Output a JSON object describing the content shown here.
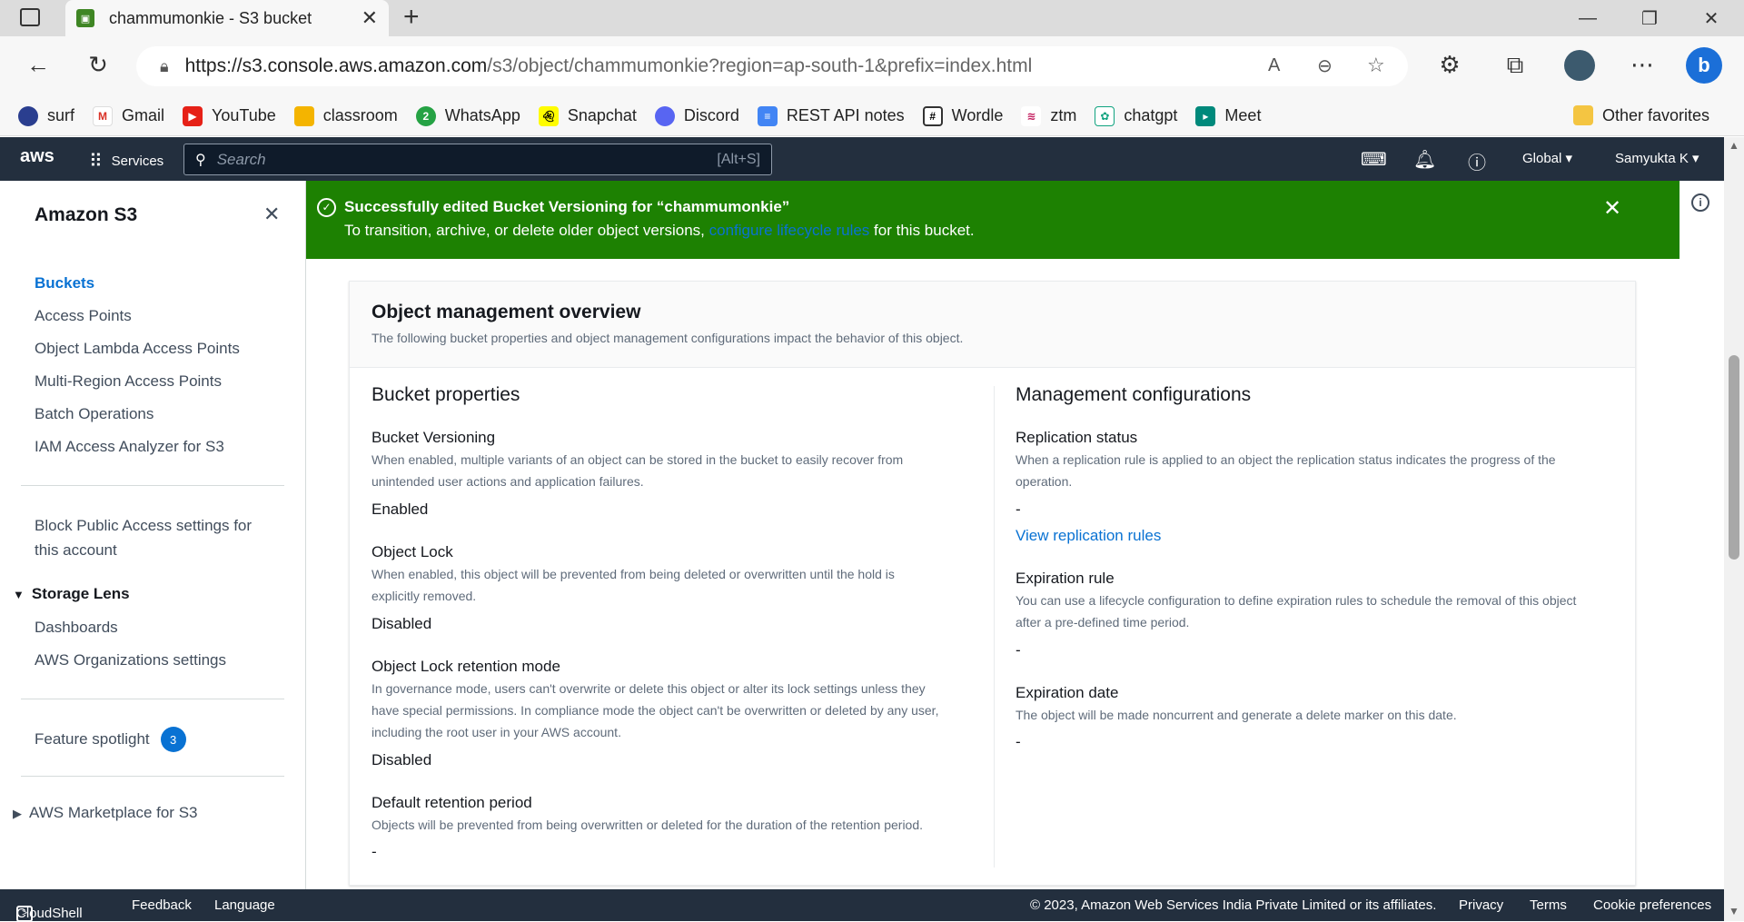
{
  "browser": {
    "tab_title": "chammumonkie - S3 bucket",
    "url_host": "https://s3.console.aws.amazon.com",
    "url_path": "/s3/object/chammumonkie?region=ap-south-1&prefix=index.html",
    "bookmarks": [
      "surf",
      "Gmail",
      "YouTube",
      "classroom",
      "WhatsApp",
      "Snapchat",
      "Discord",
      "REST API notes",
      "Wordle",
      "ztm",
      "chatgpt",
      "Meet"
    ],
    "other_favorites": "Other favorites"
  },
  "aws_header": {
    "logo": "aws",
    "services": "Services",
    "search_placeholder": "Search",
    "search_shortcut": "[Alt+S]",
    "region": "Global",
    "user": "Samyukta K"
  },
  "sidebar": {
    "title": "Amazon S3",
    "items": [
      "Buckets",
      "Access Points",
      "Object Lambda Access Points",
      "Multi-Region Access Points",
      "Batch Operations",
      "IAM Access Analyzer for S3"
    ],
    "block_public_line1": "Block Public Access settings for",
    "block_public_line2": "this account",
    "storage_lens": "Storage Lens",
    "storage_items": [
      "Dashboards",
      "AWS Organizations settings"
    ],
    "feature_spotlight": "Feature spotlight",
    "feature_badge": "3",
    "marketplace": "AWS Marketplace for S3"
  },
  "banner": {
    "title": "Successfully edited Bucket Versioning for “chammumonkie”",
    "text_before": "To transition, archive, or delete older object versions,",
    "link": "configure lifecycle rules",
    "text_after": "for this bucket."
  },
  "overview": {
    "title": "Object management overview",
    "description": "The following bucket properties and object management configurations impact the behavior of this object.",
    "bucket_properties": {
      "heading": "Bucket properties",
      "versioning_title": "Bucket Versioning",
      "versioning_desc1": "When enabled, multiple variants of an object can be stored in the bucket to easily recover from",
      "versioning_desc2": "unintended user actions and application failures.",
      "versioning_value": "Enabled",
      "lock_title": "Object Lock",
      "lock_desc1": "When enabled, this object will be prevented from being deleted or overwritten until the hold is",
      "lock_desc2": "explicitly removed.",
      "lock_value": "Disabled",
      "retention_mode_title": "Object Lock retention mode",
      "retention_mode_desc1": "In governance mode, users can't overwrite or delete this object or alter its lock settings unless they",
      "retention_mode_desc2": "have special permissions. In compliance mode the object can't be overwritten or deleted by any user,",
      "retention_mode_desc3": "including the root user in your AWS account.",
      "retention_mode_value": "Disabled",
      "retention_period_title": "Default retention period",
      "retention_period_desc": "Objects will be prevented from being overwritten or deleted for the duration of the retention period.",
      "retention_period_value": "-"
    },
    "management": {
      "heading": "Management configurations",
      "replication_title": "Replication status",
      "replication_desc1": "When a replication rule is applied to an object the replication status indicates the progress of the",
      "replication_desc2": "operation.",
      "replication_value": "-",
      "replication_link": "View replication rules",
      "expiration_rule_title": "Expiration rule",
      "expiration_rule_desc1": "You can use a lifecycle configuration to define expiration rules to schedule the removal of this object",
      "expiration_rule_desc2": "after a pre-defined time period.",
      "expiration_rule_value": "-",
      "expiration_date_title": "Expiration date",
      "expiration_date_desc": "The object will be made noncurrent and generate a delete marker on this date.",
      "expiration_date_value": "-"
    }
  },
  "footer": {
    "cloudshell": "CloudShell",
    "feedback": "Feedback",
    "language": "Language",
    "copyright": "© 2023, Amazon Web Services India Private Limited or its affiliates.",
    "privacy": "Privacy",
    "terms": "Terms",
    "cookie": "Cookie preferences"
  },
  "colors": {
    "success": "#1d8102",
    "aws_nav": "#232f3e",
    "link": "#0972d3"
  }
}
